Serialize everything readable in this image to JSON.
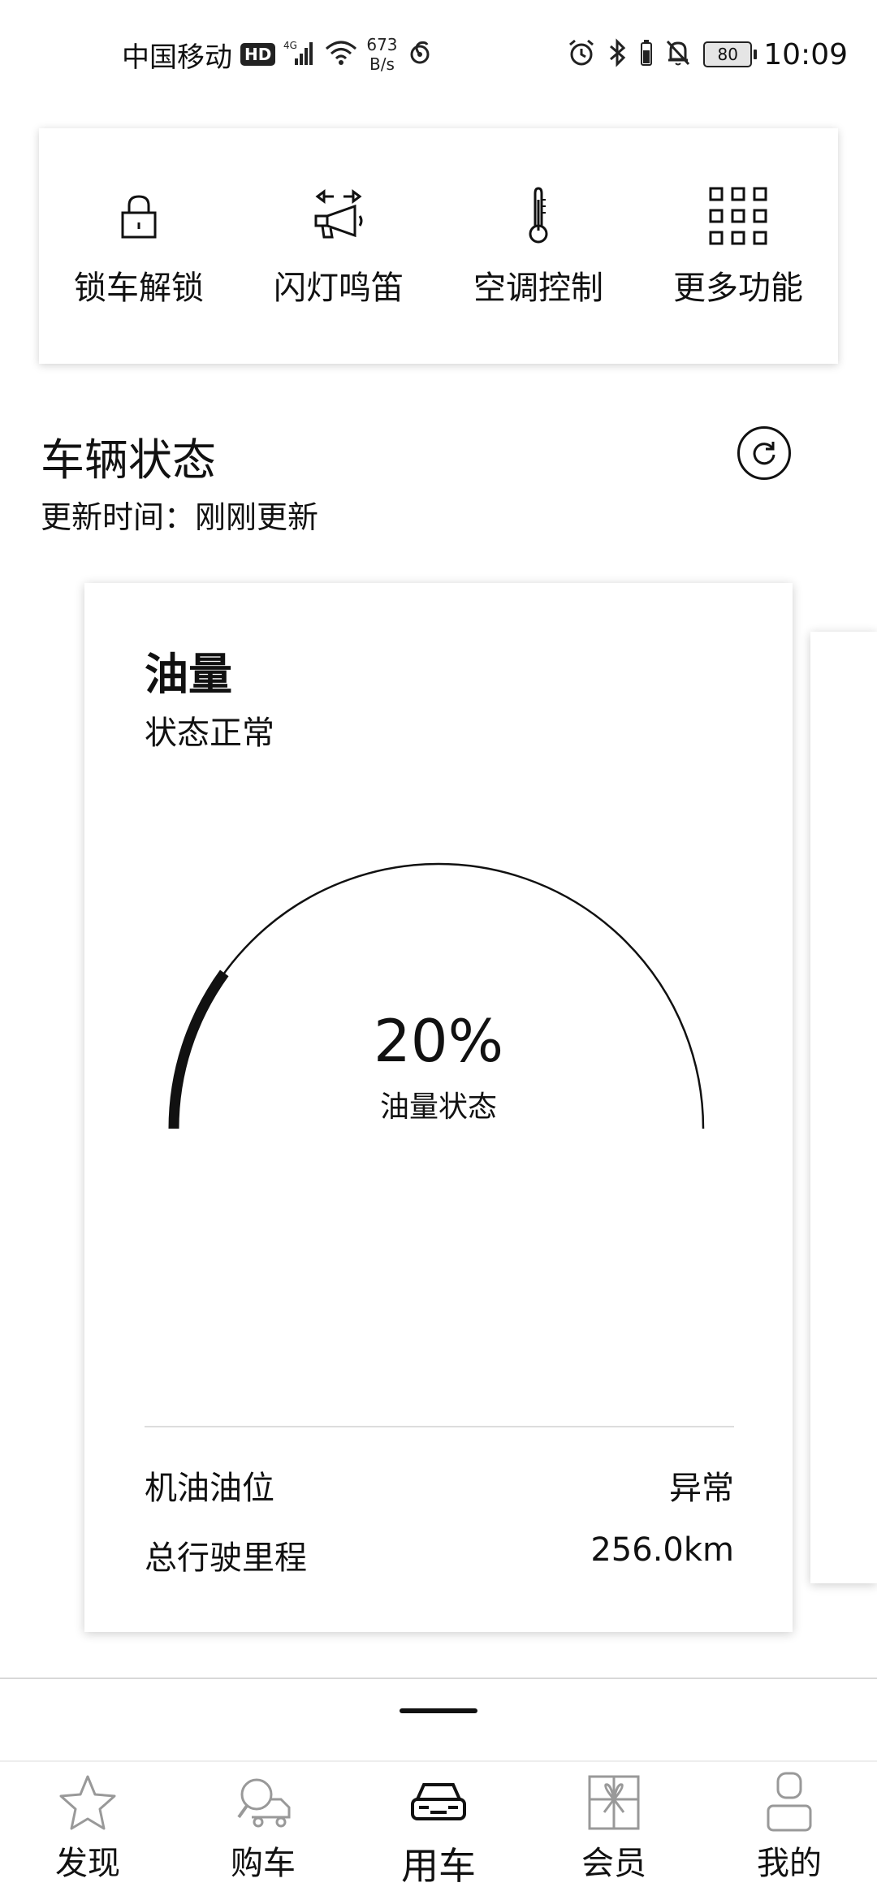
{
  "status_bar": {
    "carrier": "中国移动",
    "hd_badge": "HD",
    "network": "4G",
    "speed_value": "673",
    "speed_unit": "B/s",
    "battery": "80",
    "time": "10:09",
    "icons": [
      "hd-icon",
      "signal-icon",
      "wifi-icon",
      "app-notification-icon",
      "alarm-icon",
      "bluetooth-icon",
      "mute-icon",
      "battery-icon"
    ]
  },
  "quick_controls": [
    {
      "label": "锁车解锁",
      "icon": "lock-icon"
    },
    {
      "label": "闪灯鸣笛",
      "icon": "horn-icon"
    },
    {
      "label": "空调控制",
      "icon": "thermometer-icon"
    },
    {
      "label": "更多功能",
      "icon": "grid-icon"
    }
  ],
  "vehicle_status": {
    "title": "车辆状态",
    "update_time": "更新时间：刚刚更新",
    "refresh_icon": "refresh-icon"
  },
  "fuel_card": {
    "title": "油量",
    "status": "状态正常",
    "gauge_value": "20%",
    "gauge_fraction": 0.2,
    "gauge_label": "油量状态",
    "rows": [
      {
        "label": "机油油位",
        "value": "异常"
      },
      {
        "label": "总行驶里程",
        "value": "256.0km"
      }
    ]
  },
  "tabbar": {
    "active_index": 2,
    "tabs": [
      {
        "label": "发现",
        "icon": "star-icon"
      },
      {
        "label": "购车",
        "icon": "car-search-icon"
      },
      {
        "label": "用车",
        "icon": "car-icon"
      },
      {
        "label": "会员",
        "icon": "gift-icon"
      },
      {
        "label": "我的",
        "icon": "person-icon"
      }
    ]
  }
}
